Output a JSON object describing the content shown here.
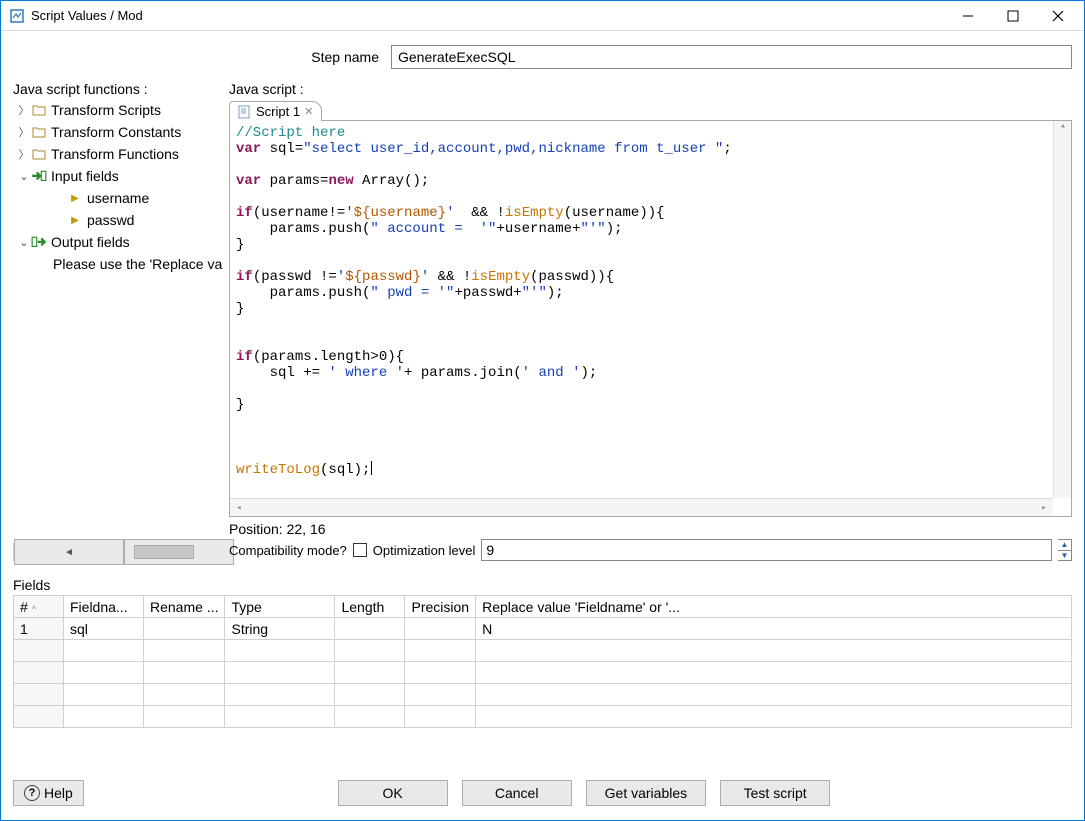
{
  "window": {
    "title": "Script Values / Mod"
  },
  "step": {
    "label": "Step name",
    "value": "GenerateExecSQL"
  },
  "leftLabel": "Java script functions :",
  "tree": {
    "nodes": [
      {
        "label": "Transform Scripts",
        "icon": "folder",
        "state": "collapsed",
        "indent": 0
      },
      {
        "label": "Transform Constants",
        "icon": "folder",
        "state": "collapsed",
        "indent": 0
      },
      {
        "label": "Transform Functions",
        "icon": "folder",
        "state": "collapsed",
        "indent": 0
      },
      {
        "label": "Input fields",
        "icon": "in",
        "state": "expanded",
        "indent": 0
      },
      {
        "label": "username",
        "icon": "pt",
        "state": "leaf",
        "indent": 1
      },
      {
        "label": "passwd",
        "icon": "pt",
        "state": "leaf",
        "indent": 1
      },
      {
        "label": "Output fields",
        "icon": "out",
        "state": "expanded",
        "indent": 0
      },
      {
        "label": "Please use the 'Replace value' field",
        "icon": "none",
        "state": "leaf",
        "indent": 1
      }
    ]
  },
  "rightLabel": "Java script :",
  "tab": {
    "label": "Script 1"
  },
  "code": {
    "lines": [
      [
        [
          "comment",
          "//Script here"
        ]
      ],
      [
        [
          "kw",
          "var"
        ],
        [
          "plain",
          " sql="
        ],
        [
          "str",
          "\"select user_id,account,pwd,nickname from t_user \""
        ],
        [
          "plain",
          ";"
        ]
      ],
      [
        [
          "plain",
          ""
        ]
      ],
      [
        [
          "kw",
          "var"
        ],
        [
          "plain",
          " params="
        ],
        [
          "kw",
          "new"
        ],
        [
          "plain",
          " Array();"
        ]
      ],
      [
        [
          "plain",
          ""
        ]
      ],
      [
        [
          "kw",
          "if"
        ],
        [
          "plain",
          "(username!="
        ],
        [
          "str",
          "'"
        ],
        [
          "tpl",
          "${username}"
        ],
        [
          "str",
          "'"
        ],
        [
          "plain",
          "  && !"
        ],
        [
          "fn",
          "isEmpty"
        ],
        [
          "plain",
          "(username)){"
        ]
      ],
      [
        [
          "plain",
          "    params.push("
        ],
        [
          "str",
          "\" account =  '\""
        ],
        [
          "plain",
          "+username+"
        ],
        [
          "str",
          "\"'\""
        ],
        [
          "plain",
          ");"
        ]
      ],
      [
        [
          "plain",
          "}"
        ]
      ],
      [
        [
          "plain",
          ""
        ]
      ],
      [
        [
          "kw",
          "if"
        ],
        [
          "plain",
          "(passwd !="
        ],
        [
          "str",
          "'"
        ],
        [
          "tpl",
          "${passwd}"
        ],
        [
          "str",
          "'"
        ],
        [
          "plain",
          " && !"
        ],
        [
          "fn",
          "isEmpty"
        ],
        [
          "plain",
          "(passwd)){"
        ]
      ],
      [
        [
          "plain",
          "    params.push("
        ],
        [
          "str",
          "\" pwd = '\""
        ],
        [
          "plain",
          "+passwd+"
        ],
        [
          "str",
          "\"'\""
        ],
        [
          "plain",
          ");"
        ]
      ],
      [
        [
          "plain",
          "}"
        ]
      ],
      [
        [
          "plain",
          ""
        ]
      ],
      [
        [
          "plain",
          ""
        ]
      ],
      [
        [
          "kw",
          "if"
        ],
        [
          "plain",
          "(params.length>0){"
        ]
      ],
      [
        [
          "plain",
          "    sql += "
        ],
        [
          "str",
          "' where '"
        ],
        [
          "plain",
          "+ params.join("
        ],
        [
          "str",
          "' and '"
        ],
        [
          "plain",
          ");"
        ]
      ],
      [
        [
          "plain",
          ""
        ]
      ],
      [
        [
          "plain",
          "}"
        ]
      ],
      [
        [
          "plain",
          ""
        ]
      ],
      [
        [
          "plain",
          ""
        ]
      ],
      [
        [
          "plain",
          ""
        ]
      ],
      [
        [
          "fn",
          "writeToLog"
        ],
        [
          "plain",
          "(sql);"
        ]
      ]
    ]
  },
  "position": {
    "label": "Position: 22, 16"
  },
  "compat": {
    "label": "Compatibility mode?"
  },
  "opt": {
    "label": "Optimization level",
    "value": "9"
  },
  "fields": {
    "label": "Fields",
    "headers": [
      "#",
      "Fieldna...",
      "Rename ...",
      "Type",
      "Length",
      "Precision",
      "Replace value 'Fieldname' or '..."
    ],
    "rows": [
      {
        "num": "1",
        "name": "sql",
        "rename": "",
        "type": "String",
        "length": "",
        "precision": "",
        "replace": "N"
      }
    ]
  },
  "buttons": {
    "help": "Help",
    "ok": "OK",
    "cancel": "Cancel",
    "getvars": "Get variables",
    "test": "Test script"
  }
}
